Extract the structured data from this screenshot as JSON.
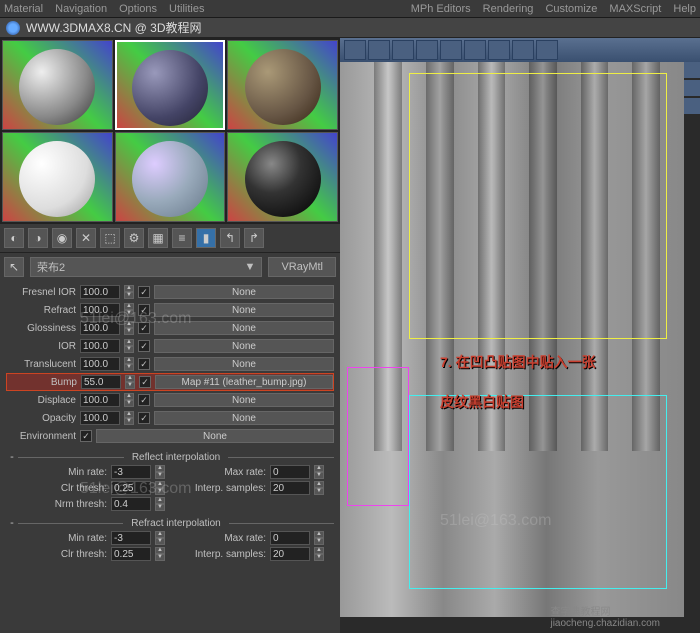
{
  "menubar": {
    "items": [
      "Material",
      "Navigation",
      "Options",
      "Utilities"
    ],
    "right_items": [
      "MPh Editors",
      "Rendering",
      "Customize",
      "MAXScript",
      "Help"
    ]
  },
  "url": "WWW.3DMAX8.CN @ 3D教程网",
  "material_name": "荣布2",
  "material_type": "VRayMtl",
  "params": [
    {
      "label": "Fresnel IOR",
      "value": "100.0",
      "checked": true,
      "map": "None"
    },
    {
      "label": "Refract",
      "value": "100.0",
      "checked": true,
      "map": "None"
    },
    {
      "label": "Glossiness",
      "value": "100.0",
      "checked": true,
      "map": "None"
    },
    {
      "label": "IOR",
      "value": "100.0",
      "checked": true,
      "map": "None"
    },
    {
      "label": "Translucent",
      "value": "100.0",
      "checked": true,
      "map": "None"
    },
    {
      "label": "Bump",
      "value": "55.0",
      "checked": true,
      "map": "Map #11 (leather_bump.jpg)",
      "highlight": true
    },
    {
      "label": "Displace",
      "value": "100.0",
      "checked": true,
      "map": "None"
    },
    {
      "label": "Opacity",
      "value": "100.0",
      "checked": true,
      "map": "None"
    },
    {
      "label": "Environment",
      "value": "",
      "checked": true,
      "map": "None"
    }
  ],
  "sections": {
    "reflect": {
      "title": "Reflect interpolation",
      "rows": [
        {
          "l1": "Min rate:",
          "v1": "-3",
          "l2": "Max rate:",
          "v2": "0"
        },
        {
          "l1": "Clr thresh:",
          "v1": "0.25",
          "l2": "Interp. samples:",
          "v2": "20"
        },
        {
          "l1": "Nrm thresh:",
          "v1": "0.4",
          "l2": "",
          "v2": ""
        }
      ]
    },
    "refract": {
      "title": "Refract interpolation",
      "rows": [
        {
          "l1": "Min rate:",
          "v1": "-3",
          "l2": "Max rate:",
          "v2": "0"
        },
        {
          "l1": "Clr thresh:",
          "v1": "0.25",
          "l2": "Interp. samples:",
          "v2": "20"
        }
      ]
    }
  },
  "annotations": {
    "line1": "7. 在凹凸贴图中贴入一张",
    "line2": "皮纹黑白贴图"
  },
  "watermarks": {
    "w1": "51lei@163.com",
    "w2": "51lei@163.com",
    "w3": "51lei@163.com"
  },
  "footer": {
    "site": "查字典教程网",
    "url": "jiaocheng.chazidian.com"
  }
}
